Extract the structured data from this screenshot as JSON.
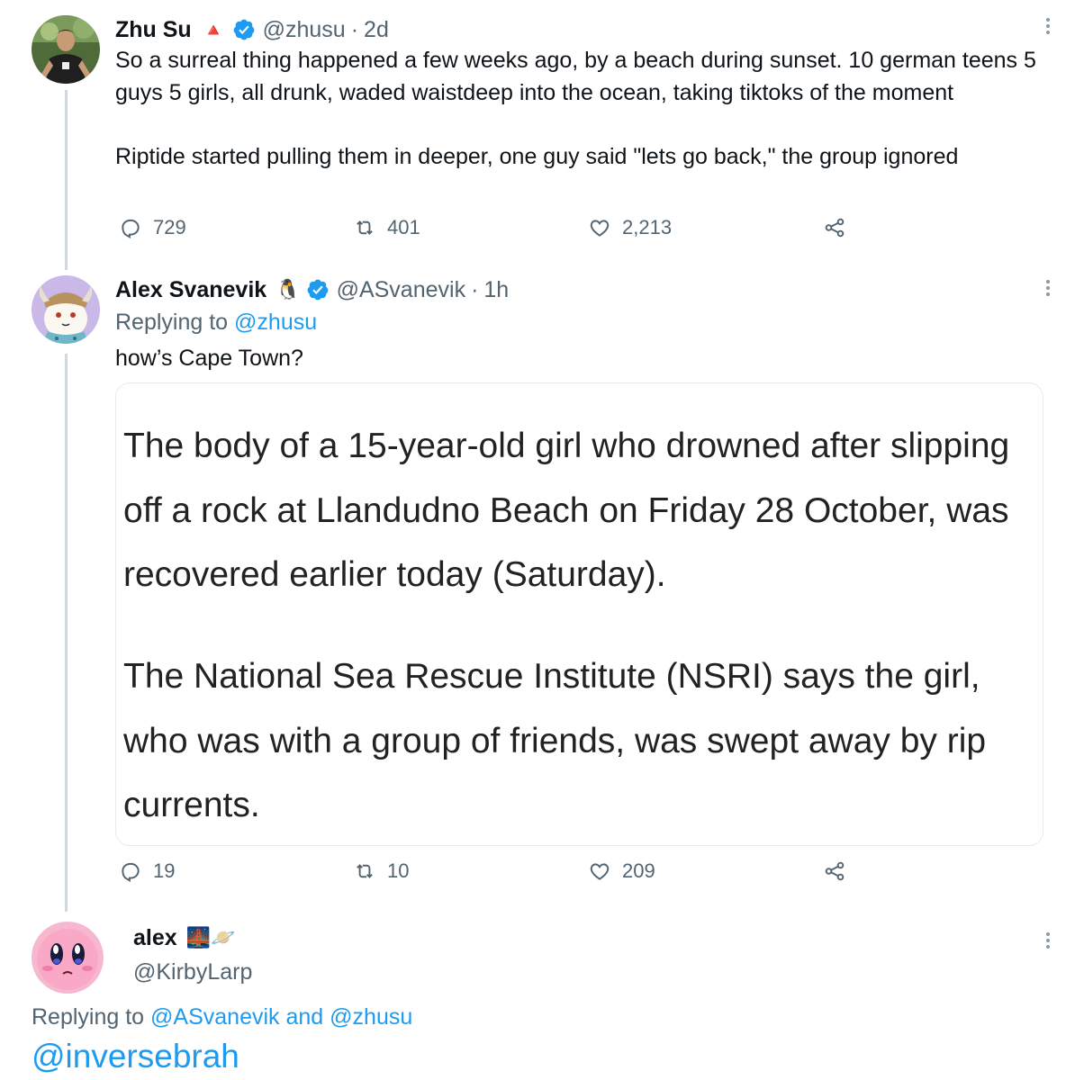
{
  "tweet1": {
    "name": "Zhu Su",
    "emoji": "🔺",
    "handle": "@zhusu",
    "separator": "·",
    "time": "2d",
    "text": "So a surreal thing happened a few weeks ago, by a beach during sunset. 10 german teens 5 guys 5 girls, all drunk, waded waistdeep into the ocean, taking tiktoks of the moment\n\nRiptide started pulling them in deeper, one guy said \"lets go back,\" the group ignored",
    "replies": "729",
    "retweets": "401",
    "likes": "2,213"
  },
  "tweet2": {
    "name": "Alex Svanevik",
    "emoji": "🐧",
    "handle": "@ASvanevik",
    "separator": "·",
    "time": "1h",
    "replying_prefix": "Replying to",
    "replying_to": "@zhusu",
    "text": "how’s Cape Town?",
    "quote_p1": "The body of a 15-year-old girl who drowned after slipping off a rock at Llandudno Beach on Friday 28 October, was recovered earlier today (Saturday).",
    "quote_p2": "The National Sea Rescue Institute (NSRI) says the girl, who was with a group of friends, was swept away by rip currents.",
    "replies": "19",
    "retweets": "10",
    "likes": "209"
  },
  "tweet3": {
    "name": "alex",
    "emoji": "🌉🪐",
    "handle": "@KirbyLarp",
    "replying_prefix": "Replying to",
    "replying_to_1": "@ASvanevik",
    "replying_and": "and",
    "replying_to_2": "@zhusu",
    "text": "@inversebrah"
  },
  "colors": {
    "text": "#0f1419",
    "secondary": "#536471",
    "accent": "#1d9bf0",
    "thread_line": "#cfd9de",
    "card_border": "#e6ecf0"
  },
  "icons": [
    "reply-icon",
    "retweet-icon",
    "like-icon",
    "share-icon",
    "verified-icon",
    "more-icon"
  ]
}
